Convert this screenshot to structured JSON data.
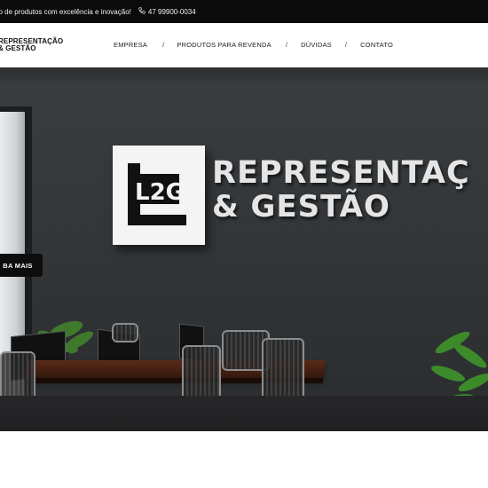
{
  "topbar": {
    "tagline": "ão de produtos com excelência e inovação!",
    "phone": "47 99900-0034"
  },
  "brand": {
    "line1": "REPRESENTAÇÃO",
    "line2": "& GESTÃO"
  },
  "nav": {
    "items": [
      "EMPRESA",
      "PRODUTOS PARA REVENDA",
      "DÚVIDAS",
      "CONTATO"
    ],
    "separator": "/"
  },
  "hero": {
    "sign_logo": "L2G",
    "sign_line1": "REPRESENTAÇ",
    "sign_line2": "& GESTÃO",
    "cta_label": "BA MAIS"
  },
  "colors": {
    "topbar_bg": "#0b0b0b",
    "wall": "#35383a",
    "cta_bg": "#0d0d0d"
  }
}
